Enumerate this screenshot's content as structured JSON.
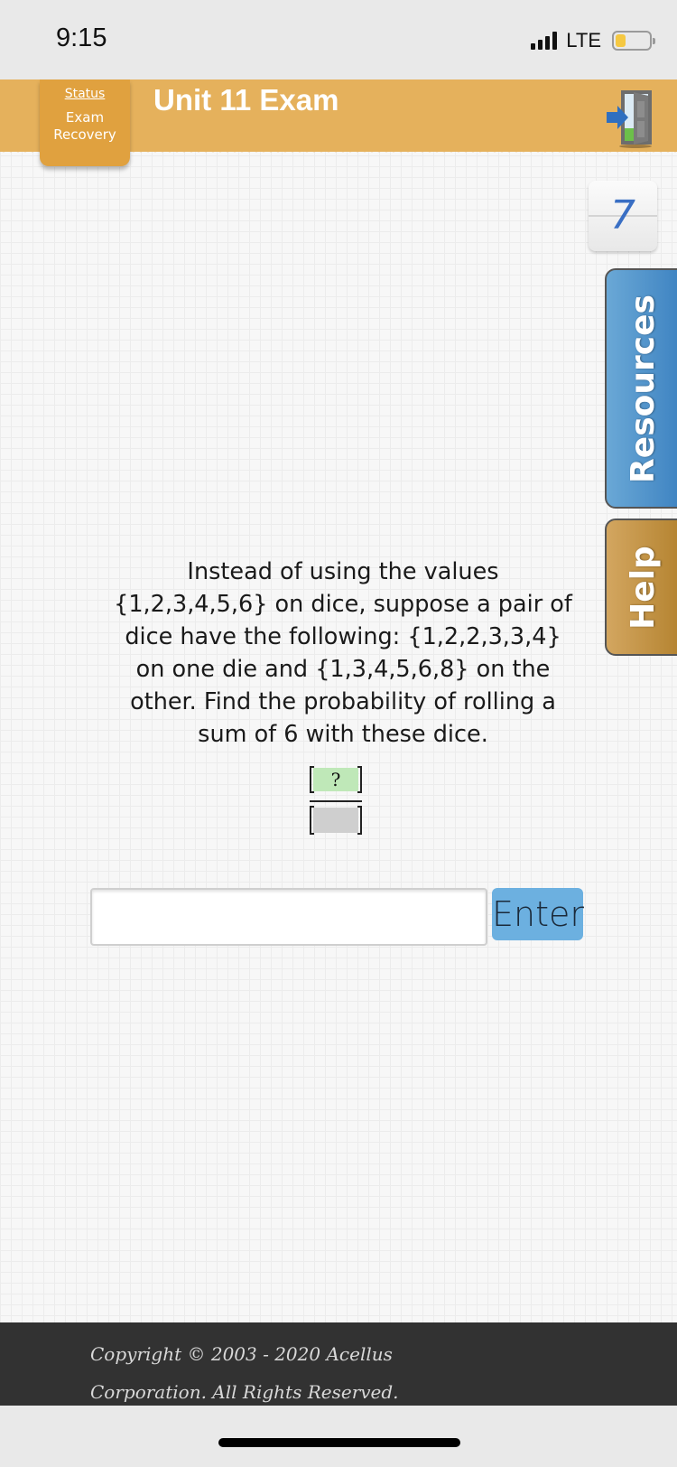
{
  "status_bar": {
    "time": "9:15",
    "network": "LTE",
    "battery_level": 0.3,
    "icons": [
      "signal-icon",
      "battery-icon"
    ]
  },
  "header": {
    "title": "Unit 11 Exam",
    "status_link": "Status",
    "status_sub": [
      "Exam",
      "Recovery"
    ],
    "exit_icon": "exit-door-icon",
    "brand_color": "#e5b15c"
  },
  "counter": {
    "value": "7"
  },
  "side_tabs": {
    "resources": {
      "label": "Resources",
      "color": "#4a8fca"
    },
    "help": {
      "label": "Help",
      "color": "#c4943f"
    }
  },
  "question": {
    "text": "Instead of using the values {1,2,3,4,5,6} on dice, suppose a pair of dice have the following:  {1,2,2,3,3,4} on one die and {1,3,4,5,6,8} on the other.  Find the probability of rolling a sum of 6 with these dice.",
    "fraction": {
      "numerator": "?",
      "denominator": ""
    }
  },
  "answer": {
    "value": "",
    "placeholder": "",
    "submit_label": "Enter"
  },
  "footer": {
    "line1": "Copyright © 2003 - 2020 Acellus",
    "line2": "Corporation.  All Rights Reserved."
  }
}
